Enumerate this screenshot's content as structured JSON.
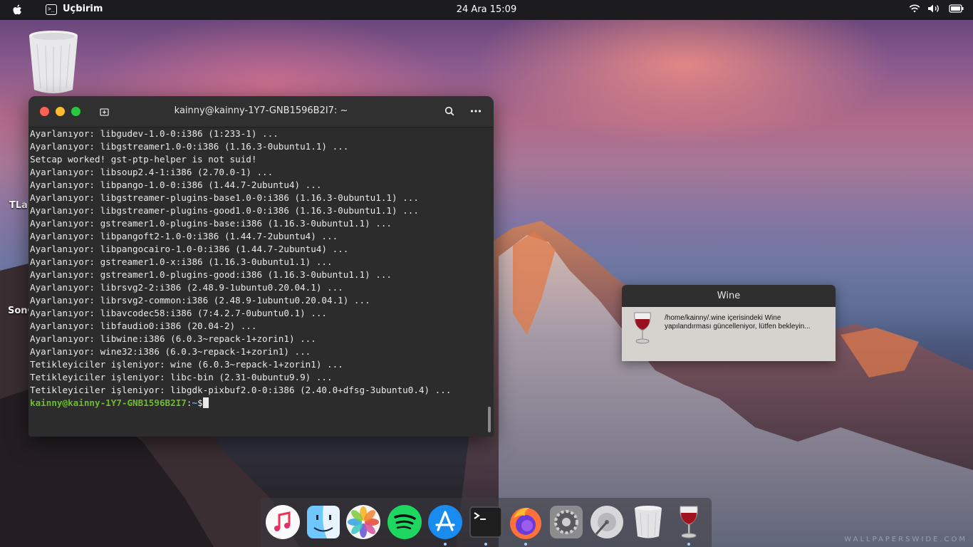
{
  "menubar": {
    "app_name": "Uçbirim",
    "clock": "24 Ara  15:09",
    "app_icon_glyph": ">_"
  },
  "desktop": {
    "labels": [
      "TLa",
      "SonC"
    ]
  },
  "terminal": {
    "title": "kainny@kainny-1Y7-GNB1596B2I7: ~",
    "lines": [
      "Ayarlanıyor: libgudev-1.0-0:i386 (1:233-1) ...",
      "Ayarlanıyor: libgstreamer1.0-0:i386 (1.16.3-0ubuntu1.1) ...",
      "Setcap worked! gst-ptp-helper is not suid!",
      "Ayarlanıyor: libsoup2.4-1:i386 (2.70.0-1) ...",
      "Ayarlanıyor: libpango-1.0-0:i386 (1.44.7-2ubuntu4) ...",
      "Ayarlanıyor: libgstreamer-plugins-base1.0-0:i386 (1.16.3-0ubuntu1.1) ...",
      "Ayarlanıyor: libgstreamer-plugins-good1.0-0:i386 (1.16.3-0ubuntu1.1) ...",
      "Ayarlanıyor: gstreamer1.0-plugins-base:i386 (1.16.3-0ubuntu1.1) ...",
      "Ayarlanıyor: libpangoft2-1.0-0:i386 (1.44.7-2ubuntu4) ...",
      "Ayarlanıyor: libpangocairo-1.0-0:i386 (1.44.7-2ubuntu4) ...",
      "Ayarlanıyor: gstreamer1.0-x:i386 (1.16.3-0ubuntu1.1) ...",
      "Ayarlanıyor: gstreamer1.0-plugins-good:i386 (1.16.3-0ubuntu1.1) ...",
      "Ayarlanıyor: librsvg2-2:i386 (2.48.9-1ubuntu0.20.04.1) ...",
      "Ayarlanıyor: librsvg2-common:i386 (2.48.9-1ubuntu0.20.04.1) ...",
      "Ayarlanıyor: libavcodec58:i386 (7:4.2.7-0ubuntu0.1) ...",
      "Ayarlanıyor: libfaudio0:i386 (20.04-2) ...",
      "Ayarlanıyor: libwine:i386 (6.0.3~repack-1+zorin1) ...",
      "Ayarlanıyor: wine32:i386 (6.0.3~repack-1+zorin1) ...",
      "Tetikleyiciler işleniyor: wine (6.0.3~repack-1+zorin1) ...",
      "Tetikleyiciler işleniyor: libc-bin (2.31-0ubuntu9.9) ...",
      "Tetikleyiciler işleniyor: libgdk-pixbuf2.0-0:i386 (2.40.0+dfsg-3ubuntu0.4) ..."
    ],
    "prompt_user": "kainny@kainny-1Y7-GNB1596B2I7",
    "prompt_sep": ":",
    "prompt_path": "~",
    "prompt_symbol": "$"
  },
  "wine_dialog": {
    "title": "Wine",
    "message": "/home/kainny/.wine içerisindeki Wine yapılandırması güncelleniyor, lütfen bekleyin..."
  },
  "dock": {
    "items": [
      {
        "name": "itunes",
        "icon": "music-note-icon",
        "running": false
      },
      {
        "name": "finder",
        "icon": "finder-face-icon",
        "running": false
      },
      {
        "name": "photos",
        "icon": "photos-flower-icon",
        "running": false
      },
      {
        "name": "spotify",
        "icon": "spotify-icon",
        "running": false
      },
      {
        "name": "app-store",
        "icon": "app-store-icon",
        "running": true
      },
      {
        "name": "terminal",
        "icon": "terminal-icon",
        "running": true
      },
      {
        "name": "firefox",
        "icon": "firefox-icon",
        "running": true
      },
      {
        "name": "system-preferences",
        "icon": "gear-icon",
        "running": false
      },
      {
        "name": "disk-utility",
        "icon": "disk-icon",
        "running": false
      },
      {
        "name": "trash",
        "icon": "trash-icon",
        "running": false
      },
      {
        "name": "wine",
        "icon": "wine-glass-icon",
        "running": true
      }
    ]
  },
  "watermark": "WALLPAPERSWIDE.COM",
  "colors": {
    "prompt_user": "#6dbb2f",
    "prompt_path": "#7aa7e0",
    "terminal_bg": "#2c2c2c",
    "menubar_bg": "#1c1c1e"
  }
}
